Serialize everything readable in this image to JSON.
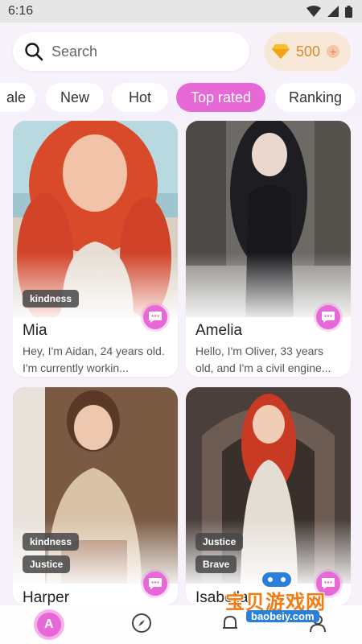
{
  "status": {
    "time": "6:16"
  },
  "search": {
    "placeholder": "Search"
  },
  "coins": {
    "value": "500",
    "plus": "+"
  },
  "tabs": [
    {
      "label": "ale"
    },
    {
      "label": "New"
    },
    {
      "label": "Hot"
    },
    {
      "label": "Top rated",
      "active": true
    },
    {
      "label": "Ranking"
    }
  ],
  "cards": [
    {
      "name": "Mia",
      "desc": "Hey, I'm Aidan, 24 years old. I'm currently workin...",
      "tags": [
        "kindness"
      ]
    },
    {
      "name": "Amelia",
      "desc": "Hello, I'm Oliver, 33 years old, and I'm a civil engine...",
      "tags": []
    },
    {
      "name": "Harper",
      "desc": "",
      "tags": [
        "kindness",
        "Justice"
      ]
    },
    {
      "name": "Isabella",
      "desc": "",
      "tags": [
        "Justice",
        "Brave"
      ]
    }
  ],
  "nav": {
    "home_glyph": "A"
  },
  "watermark": {
    "text": "宝贝游戏网",
    "sub": "baobeiy.com"
  },
  "colors": {
    "accent": "#e769d7",
    "coin": "#d98a2b"
  }
}
